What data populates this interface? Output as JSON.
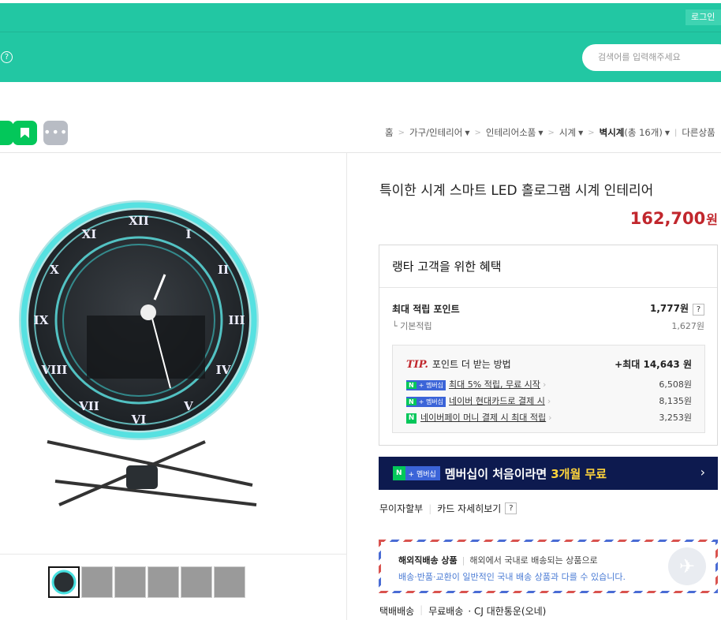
{
  "header": {
    "login_label": "로그인",
    "help_icon": "?",
    "search_placeholder": "검색어를 입력해주세요",
    "brand_color": "#22c7a3"
  },
  "share": {
    "more_label": "•••"
  },
  "breadcrumb": {
    "home": "홈",
    "level1": "가구/인테리어",
    "level2": "인테리어소품",
    "level3": "시계",
    "level4": "벽시계",
    "level4_count": "(총 16개)",
    "other": "다른상품"
  },
  "product": {
    "title": "특이한 시계 스마트 LED 홀로그램 시계 인테리어",
    "price": "162,700",
    "price_unit": "원",
    "price_color": "#c1272d"
  },
  "benefit": {
    "title": "랭타 고객을 위한 혜택",
    "max_point_label": "최대 적립 포인트",
    "max_point_value": "1,777원",
    "base_label": "기본적립",
    "base_value": "1,627원",
    "tip_label": "TIP.",
    "tip_text": "포인트 더 받는 방법",
    "tip_max": "+최대 14,643 원",
    "items": [
      {
        "badge_n": "N",
        "badge": "+ 멤버십",
        "text": "최대 5% 적립, 무료 시작",
        "value": "6,508원"
      },
      {
        "badge_n": "N",
        "badge": "+ 멤버십",
        "text": "네이버 현대카드로 결제 시",
        "value": "8,135원"
      },
      {
        "badge_n": "N",
        "badge": "",
        "text": "네이버페이 머니 결제 시 최대 적립",
        "value": "3,253원"
      }
    ]
  },
  "banner": {
    "badge_n": "N",
    "badge": "+ 멤버십",
    "text": "멤버십이 처음이라면",
    "highlight": "3개월 무료",
    "arrow": "›"
  },
  "payment_links": {
    "installment": "무이자할부",
    "card_detail": "카드 자세히보기",
    "help": "?"
  },
  "overseas": {
    "label": "해외직배송 상품",
    "desc": "해외에서 국내로 배송되는 상품으로",
    "note": "배송·반품·교환이 일반적인 국내 배송 상품과 다를 수 있습니다."
  },
  "shipping": {
    "type": "택배배송",
    "fee": "무료배송",
    "courier": "· CJ 대한통운(오네)"
  }
}
